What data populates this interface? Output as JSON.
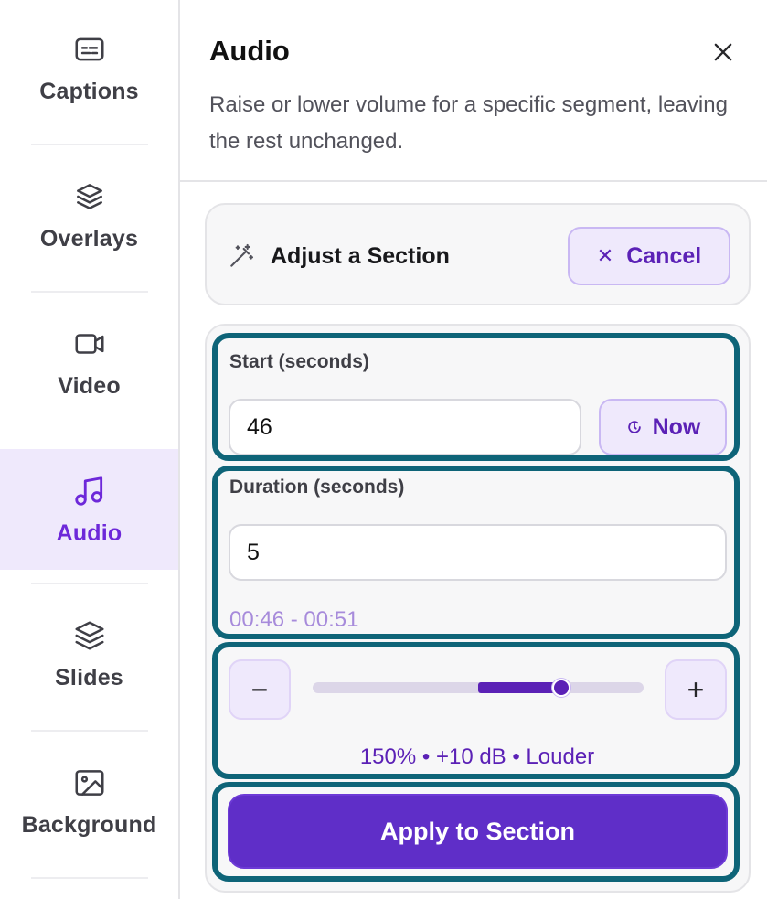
{
  "sidebar": {
    "items": [
      {
        "label": "Captions",
        "icon": "captions-icon",
        "active": false
      },
      {
        "label": "Overlays",
        "icon": "layers-icon",
        "active": false
      },
      {
        "label": "Video",
        "icon": "video-camera-icon",
        "active": false
      },
      {
        "label": "Audio",
        "icon": "music-note-icon",
        "active": true
      },
      {
        "label": "Slides",
        "icon": "slides-stack-icon",
        "active": false
      },
      {
        "label": "Background",
        "icon": "image-icon",
        "active": false
      }
    ]
  },
  "panel": {
    "title": "Audio",
    "description": "Raise or lower volume for a specific segment, leaving the rest unchanged."
  },
  "adjust": {
    "title": "Adjust a Section",
    "icon": "magic-wand-icon",
    "cancel_label": "Cancel"
  },
  "form": {
    "start_label": "Start (seconds)",
    "start_value": "46",
    "now_label": "Now",
    "duration_label": "Duration (seconds)",
    "duration_value": "5",
    "range_text": "00:46 - 00:51"
  },
  "volume": {
    "minus_label": "−",
    "plus_label": "+",
    "slider_level": 0.75,
    "fill_start": 0.5,
    "readout": "150% • +10 dB • Louder"
  },
  "apply_label": "Apply to Section",
  "colors": {
    "accent": "#5f2ec8",
    "accent_soft": "#efe9fc",
    "highlight_border": "#0e6478",
    "range_text": "#a78bdb"
  }
}
